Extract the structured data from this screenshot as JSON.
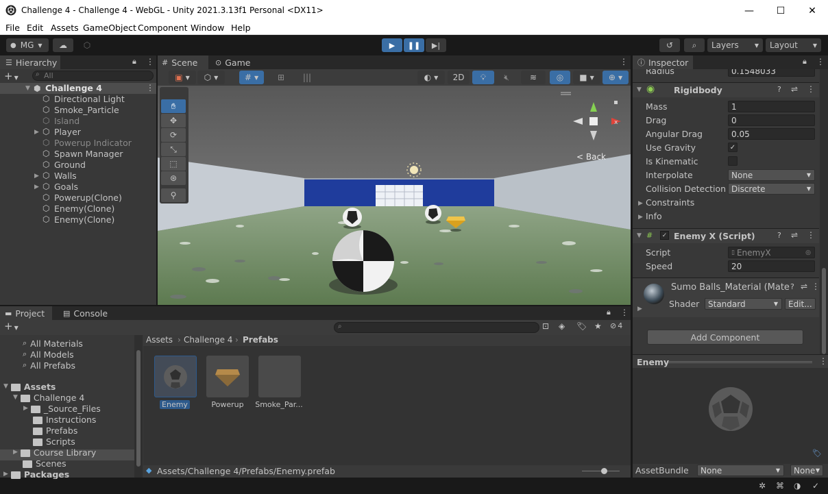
{
  "window": {
    "title": "Challenge 4 - Challenge 4 - WebGL - Unity 2021.3.13f1 Personal <DX11>",
    "minimize": "—",
    "maximize": "☐",
    "close": "✕"
  },
  "menu": [
    "File",
    "Edit",
    "Assets",
    "GameObject",
    "Component",
    "Window",
    "Help"
  ],
  "toolbar": {
    "account": "MG",
    "layers": "Layers",
    "layout": "Layout"
  },
  "hierarchy": {
    "tab": "Hierarchy",
    "search_placeholder": "All",
    "scene": "Challenge 4",
    "items": [
      {
        "label": "Directional Light",
        "active": true,
        "expandable": false
      },
      {
        "label": "Smoke_Particle",
        "active": true,
        "expandable": false
      },
      {
        "label": "Island",
        "active": false,
        "expandable": false
      },
      {
        "label": "Player",
        "active": true,
        "expandable": true
      },
      {
        "label": "Powerup Indicator",
        "active": false,
        "expandable": false
      },
      {
        "label": "Spawn Manager",
        "active": true,
        "expandable": false
      },
      {
        "label": "Ground",
        "active": true,
        "expandable": false
      },
      {
        "label": "Walls",
        "active": true,
        "expandable": true
      },
      {
        "label": "Goals",
        "active": true,
        "expandable": true
      },
      {
        "label": "Powerup(Clone)",
        "active": true,
        "expandable": false
      },
      {
        "label": "Enemy(Clone)",
        "active": true,
        "expandable": false
      },
      {
        "label": "Enemy(Clone)",
        "active": true,
        "expandable": false
      }
    ]
  },
  "scene_view": {
    "tab_scene": "Scene",
    "tab_game": "Game",
    "btn_2d": "2D",
    "back_label": "< Back",
    "gizmo_x": "x"
  },
  "inspector": {
    "tab": "Inspector",
    "radius_label": "Radius",
    "radius_value": "0.1548033",
    "rigidbody": {
      "title": "Rigidbody",
      "fields": [
        {
          "label": "Mass",
          "value": "1"
        },
        {
          "label": "Drag",
          "value": "0"
        },
        {
          "label": "Angular Drag",
          "value": "0.05"
        }
      ],
      "use_gravity": "Use Gravity",
      "is_kinematic": "Is Kinematic",
      "interpolate_label": "Interpolate",
      "interpolate_value": "None",
      "collision_label": "Collision Detection",
      "collision_value": "Discrete",
      "constraints": "Constraints",
      "info": "Info"
    },
    "script": {
      "title": "Enemy X (Script)",
      "script_label": "Script",
      "script_value": "EnemyX",
      "speed_label": "Speed",
      "speed_value": "20"
    },
    "material": {
      "title": "Sumo Balls_Material (Mate",
      "shader_label": "Shader",
      "shader_value": "Standard",
      "edit": "Edit..."
    },
    "add_component": "Add Component",
    "preview_title": "Enemy",
    "assetbundle_label": "AssetBundle",
    "assetbundle_value": "None",
    "assetbundle_variant": "None"
  },
  "project": {
    "tab_project": "Project",
    "tab_console": "Console",
    "hidden_count": "4",
    "favorites": [
      "All Materials",
      "All Models",
      "All Prefabs"
    ],
    "tree": {
      "assets": "Assets",
      "challenge": "Challenge 4",
      "children": [
        "_Source_Files",
        "Instructions",
        "Prefabs",
        "Scripts"
      ],
      "course_library": "Course Library",
      "scenes": "Scenes",
      "packages": "Packages"
    },
    "breadcrumb": [
      "Assets",
      "Challenge 4",
      "Prefabs"
    ],
    "assets": [
      "Enemy",
      "Powerup",
      "Smoke_Par..."
    ],
    "footer_path": "Assets/Challenge 4/Prefabs/Enemy.prefab"
  }
}
